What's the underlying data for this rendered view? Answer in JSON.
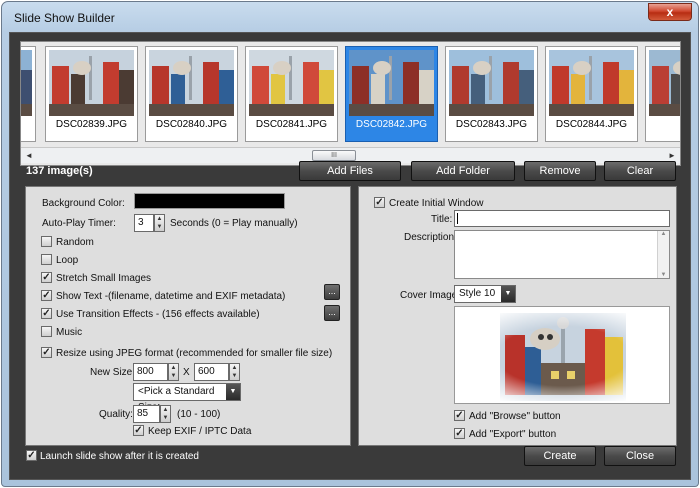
{
  "window": {
    "title": "Slide Show Builder",
    "close_glyph": "x"
  },
  "thumbnails": [
    {
      "name": "s",
      "selected": false
    },
    {
      "name": "DSC02839.JPG",
      "selected": false
    },
    {
      "name": "DSC02840.JPG",
      "selected": false
    },
    {
      "name": "DSC02841.JPG",
      "selected": false
    },
    {
      "name": "DSC02842.JPG",
      "selected": true
    },
    {
      "name": "DSC02843.JPG",
      "selected": false
    },
    {
      "name": "DSC02844.JPG",
      "selected": false
    },
    {
      "name": "DS",
      "selected": false
    }
  ],
  "scrollbar": {
    "left_arrow": "◄",
    "right_arrow": "►",
    "thumb_grip": "III"
  },
  "image_count": "137 image(s)",
  "toolbar": {
    "add_files": "Add Files",
    "add_folder": "Add Folder",
    "remove": "Remove",
    "clear": "Clear"
  },
  "left_panel": {
    "background_color_label": "Background Color:",
    "background_color_value": "#000000",
    "auto_play_label": "Auto-Play Timer:",
    "auto_play_value": "3",
    "auto_play_hint": "Seconds (0 = Play  manually)",
    "random_label": "Random",
    "random_checked": false,
    "loop_label": "Loop",
    "loop_checked": false,
    "stretch_label": "Stretch Small Images",
    "stretch_checked": true,
    "show_text_label": "Show Text -(filename, datetime and EXIF metadata)",
    "show_text_checked": true,
    "transition_label": "Use Transition Effects   -    (156 effects available)",
    "transition_checked": true,
    "music_label": "Music",
    "music_checked": false,
    "resize_label": "Resize using JPEG format (recommended for smaller file size)",
    "resize_checked": true,
    "new_size_label": "New Size:",
    "width": "800",
    "x_sep": "X",
    "height": "600",
    "standard_size": "<Pick a Standard Size>",
    "quality_label": "Quality:",
    "quality_value": "85",
    "quality_range": "(10 - 100)",
    "keep_exif_label": "Keep EXIF / IPTC Data",
    "keep_exif_checked": true,
    "ellipsis": "..."
  },
  "right_panel": {
    "create_initial_label": "Create Initial Window",
    "create_initial_checked": true,
    "title_label": "Title:",
    "title_value": "",
    "description_label": "Description:",
    "cover_label": "Cover Image:",
    "cover_style": "Style 10",
    "add_browse_label": "Add \"Browse\" button",
    "add_browse_checked": true,
    "add_export_label": "Add \"Export\" button",
    "add_export_checked": true
  },
  "footer": {
    "launch_label": "Launch slide show after it is created",
    "launch_checked": true,
    "create": "Create",
    "close": "Close"
  },
  "check_glyph": "✓",
  "colors": {
    "selection": "#2d86e6",
    "dialog_bg": "#3a3a3a",
    "panel_bg": "#dedede"
  }
}
